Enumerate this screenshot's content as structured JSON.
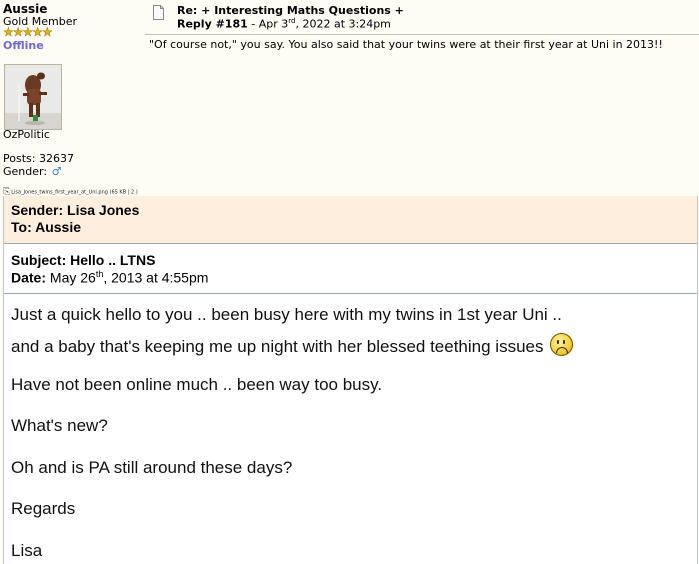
{
  "user": {
    "name": "Aussie",
    "rank": "Gold Member",
    "stars": "★★★★★",
    "status": "Offline",
    "avatar_caption": "OzPolitic",
    "posts": "Posts: 32637",
    "gender_label": "Gender:",
    "gender_icon": "male-icon"
  },
  "post": {
    "title": "Re: + Interesting Maths Questions +",
    "reply": "Reply #181",
    "date_prefix": " - Apr 3",
    "date_sup": "rd",
    "date_suffix": ", 2022 at 3:24pm",
    "text": "\"Of course not,\" you say.  You also said that your twins were at their first year at Uni in 2013!!"
  },
  "attachment": {
    "filename": "Lisa_Jones_twins_first_year_at_Uni.png",
    "info": "(65 KB | 2 )"
  },
  "message": {
    "sender": "Sender: Lisa Jones",
    "to": "To: Aussie",
    "subject": "Subject: Hello .. LTNS",
    "date_label": "Date:",
    "date_value": " May 26",
    "date_sup": "th",
    "date_suffix": ", 2013 at 4:55pm",
    "lines": [
      "Just a quick hello to you .. been busy here with my twins in 1st year Uni ..",
      "and a baby that's keeping me up night with her blessed teething issues",
      "Have not been online much .. been way too busy.",
      "What's new?",
      "Oh and is PA still around these days?",
      "Regards",
      "Lisa"
    ]
  },
  "colors": {
    "page_bg": "#fefdf5",
    "status": "#7065d9",
    "header_bg": "#fdeedd"
  }
}
